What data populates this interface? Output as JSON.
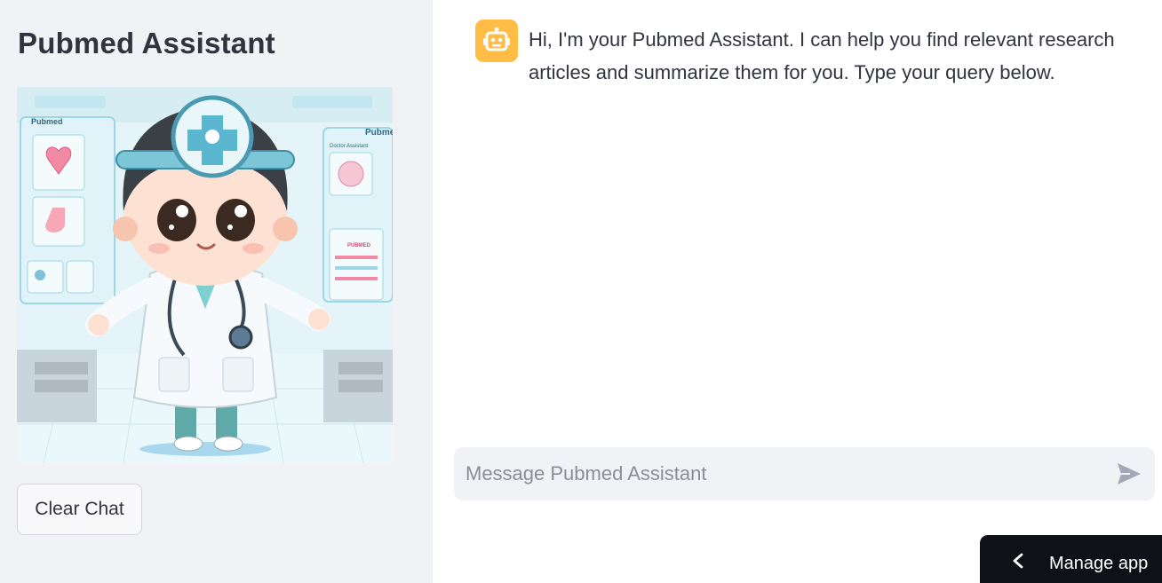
{
  "sidebar": {
    "title": "Pubmed Assistant",
    "image_alt": "Cartoon doctor assistant in a medical lab",
    "image_texts": {
      "left_panel": "Pubmed",
      "right_panel": "Pubme",
      "doctor_label": "Doctor Assistant",
      "list_label": "PUBMED"
    },
    "clear_button_label": "Clear Chat"
  },
  "chat": {
    "messages": [
      {
        "role": "assistant",
        "avatar_icon": "robot-icon",
        "avatar_color": "#ffbd45",
        "text": "Hi, I'm your Pubmed Assistant. I can help you find relevant research articles and summarize them for you. Type your query below."
      }
    ],
    "input": {
      "value": "",
      "placeholder": "Message Pubmed Assistant",
      "send_icon": "send-icon"
    }
  },
  "manage_app": {
    "label": "Manage app",
    "icon": "chevron-left-icon"
  },
  "colors": {
    "sidebar_bg": "#f0f2f6",
    "accent": "#ffbd45",
    "dark_button": "#0e1117"
  }
}
